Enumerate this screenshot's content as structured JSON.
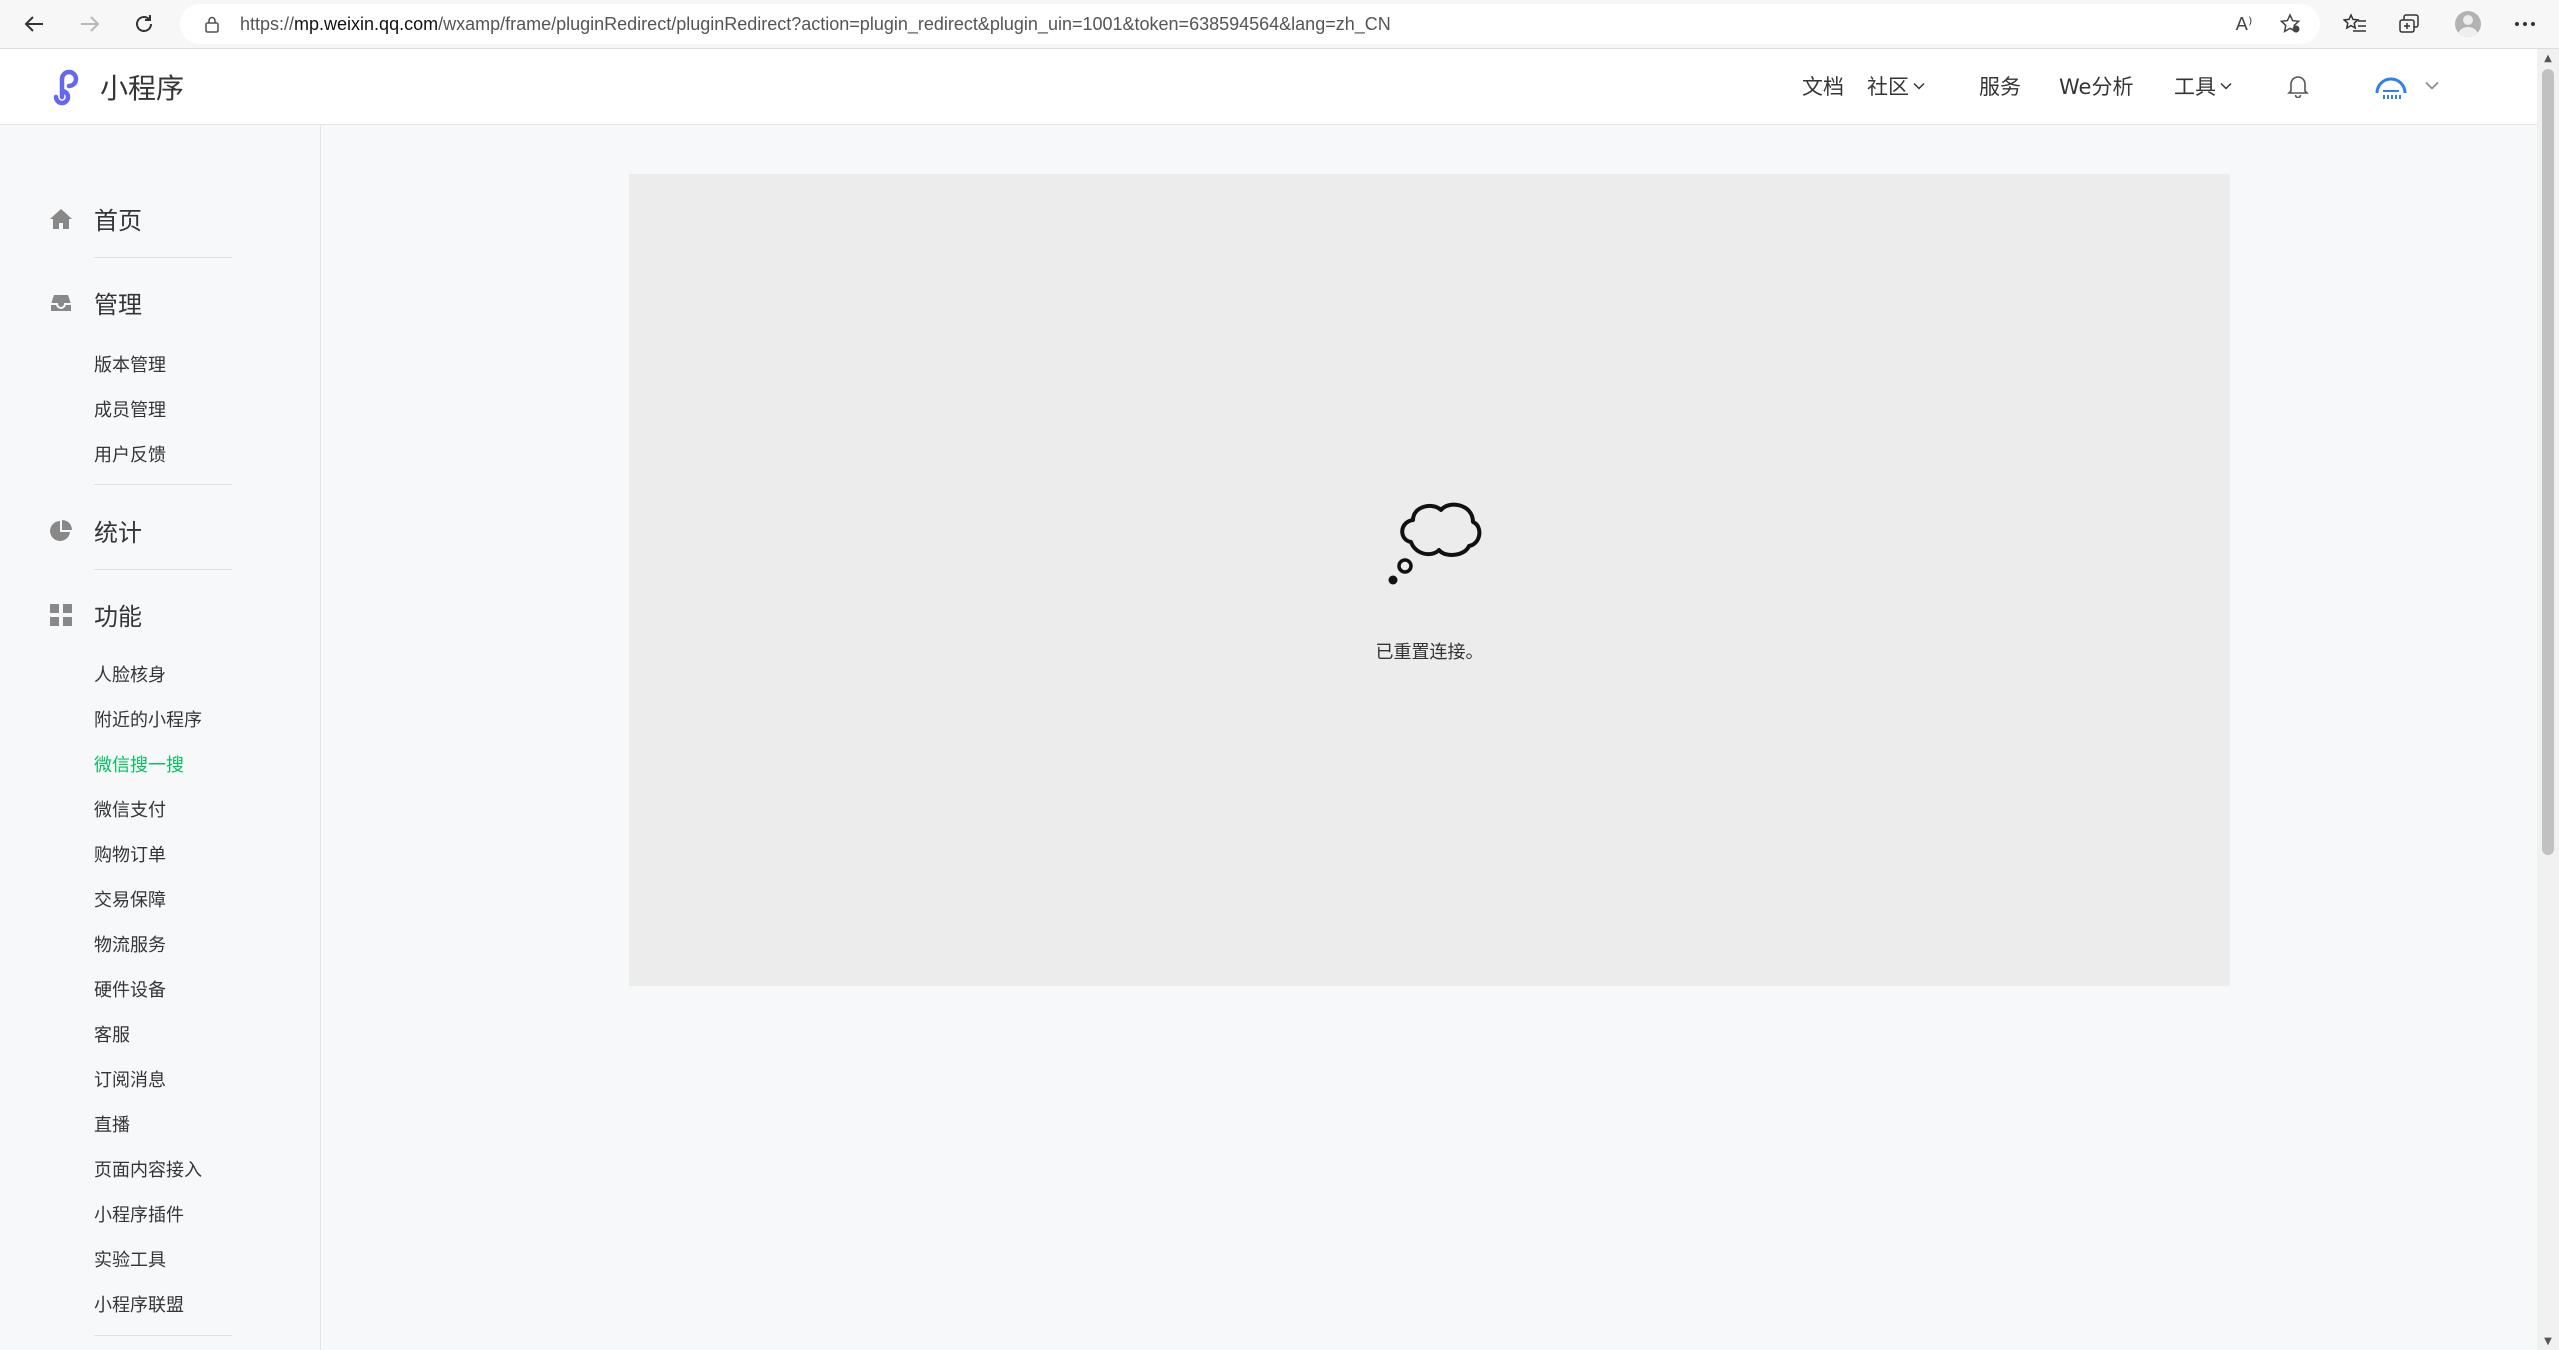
{
  "browser": {
    "url_prefix": "https://",
    "url_host": "mp.weixin.qq.com",
    "url_path": "/wxamp/frame/pluginRedirect/pluginRedirect?action=plugin_redirect&plugin_uin=1001&token=638594564&lang=zh_CN",
    "read_aloud_glyph": "A⁾"
  },
  "header": {
    "logo_text": "小程序",
    "nav": {
      "docs": "文档",
      "community": "社区",
      "service": "服务",
      "analysis": "We分析",
      "tools": "工具"
    }
  },
  "sidebar": {
    "home": "首页",
    "manage": {
      "title": "管理",
      "items": [
        "版本管理",
        "成员管理",
        "用户反馈"
      ]
    },
    "stats": "统计",
    "features": {
      "title": "功能",
      "items": [
        "人脸核身",
        "附近的小程序",
        "微信搜一搜",
        "微信支付",
        "购物订单",
        "交易保障",
        "物流服务",
        "硬件设备",
        "客服",
        "订阅消息",
        "直播",
        "页面内容接入",
        "小程序插件",
        "实验工具",
        "小程序联盟"
      ]
    },
    "active_item": "微信搜一搜"
  },
  "content": {
    "error_message": "已重置连接。"
  },
  "colors": {
    "accent_active": "#07c160",
    "logo_purple": "#6467f0",
    "frame_bg": "#ececec"
  }
}
